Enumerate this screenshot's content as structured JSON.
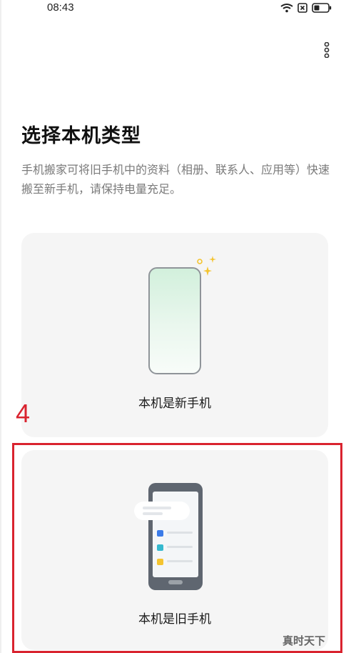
{
  "status_bar": {
    "time": "08:43"
  },
  "header": {
    "title": "选择本机类型",
    "description": "手机搬家可将旧手机中的资料（相册、联系人、应用等）快速搬至新手机，请保持电量充足。"
  },
  "options": [
    {
      "label": "本机是新手机",
      "icon": "new-phone-illustration"
    },
    {
      "label": "本机是旧手机",
      "icon": "old-phone-illustration"
    }
  ],
  "annotation": {
    "number": "4",
    "color": "#d9232f"
  },
  "watermark": "真时天下",
  "colors": {
    "card_background": "#f5f5f5",
    "new_phone_screen": "#d2f0dc",
    "old_phone_body": "#5f6670",
    "sparkle": "#f4c430"
  },
  "icons": {
    "wifi": "wifi-icon",
    "sim": "sim-icon",
    "battery": "battery-icon",
    "more": "more-vertical-icon"
  }
}
